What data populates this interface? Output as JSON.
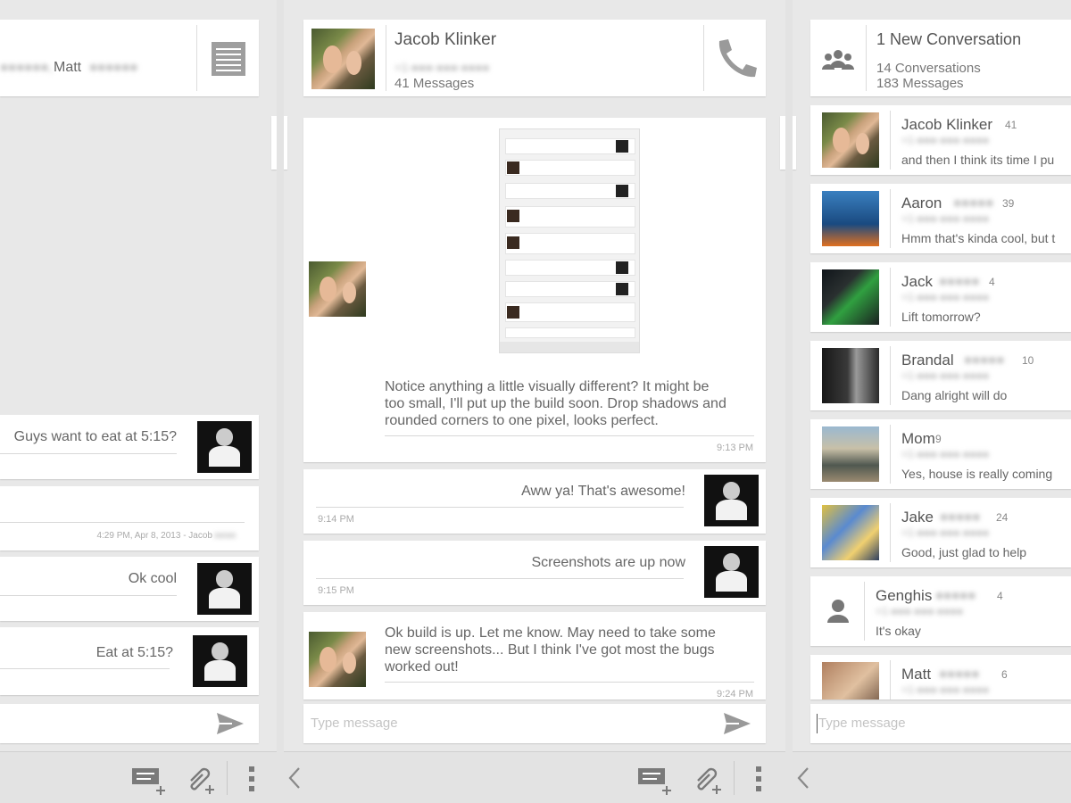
{
  "left": {
    "header": {
      "names": "Matt"
    },
    "messages": [
      {
        "text": "Guys want to eat at 5:15?"
      },
      {
        "text": "",
        "time": "4:29 PM, Apr 8, 2013 - Jacob"
      },
      {
        "text": "Ok cool"
      },
      {
        "text": "Eat at 5:15?"
      }
    ]
  },
  "middle": {
    "header": {
      "name": "Jacob Klinker",
      "count": "41 Messages"
    },
    "messages": [
      {
        "text_lines": [
          "Notice anything a little visually different? It might be",
          "too small, I'll put up the build soon. Drop shadows and",
          "rounded corners to one pixel, looks perfect."
        ],
        "time": "9:13 PM"
      },
      {
        "text": "Aww ya! That's awesome!",
        "time": "9:14 PM"
      },
      {
        "text": "Screenshots are up now",
        "time": "9:15 PM"
      },
      {
        "text_lines": [
          "Ok build is up. Let me know. May need to take some",
          "new screenshots... But I think I've got most the bugs",
          "worked out!"
        ],
        "time": "9:24 PM"
      }
    ],
    "input_placeholder": "Type message"
  },
  "right": {
    "header": {
      "title": "1 New Conversation",
      "conversations": "14 Conversations",
      "messages": "183 Messages"
    },
    "conversations": [
      {
        "name": "Jacob Klinker",
        "count": "41",
        "snippet": "and then I think its time I pu"
      },
      {
        "name": "Aaron",
        "count": "39",
        "snippet": "Hmm that's kinda cool, but t"
      },
      {
        "name": "Jack",
        "count": "4",
        "snippet": "Lift tomorrow?"
      },
      {
        "name": "Brandal",
        "count": "10",
        "snippet": "Dang alright will do"
      },
      {
        "name": "Mom",
        "count": "9",
        "snippet": "Yes, house is really coming"
      },
      {
        "name": "Jake",
        "count": "24",
        "snippet": "Good, just glad to help"
      },
      {
        "name": "Genghis",
        "count": "4",
        "snippet": "It's okay"
      },
      {
        "name": "Matt",
        "count": "6",
        "snippet": ""
      }
    ],
    "input_placeholder": "Type message"
  },
  "icons": {
    "send": "send-icon",
    "attach": "paperclip-add-icon",
    "new_msg": "new-message-icon",
    "menu": "overflow-menu-icon",
    "back": "chevron-left-icon",
    "phone": "phone-icon",
    "contacts": "group-icon",
    "person": "person-icon"
  },
  "colors": {
    "background": "#e8e8e8",
    "card": "#ffffff",
    "text": "#555555",
    "muted": "#aaaaaa"
  }
}
